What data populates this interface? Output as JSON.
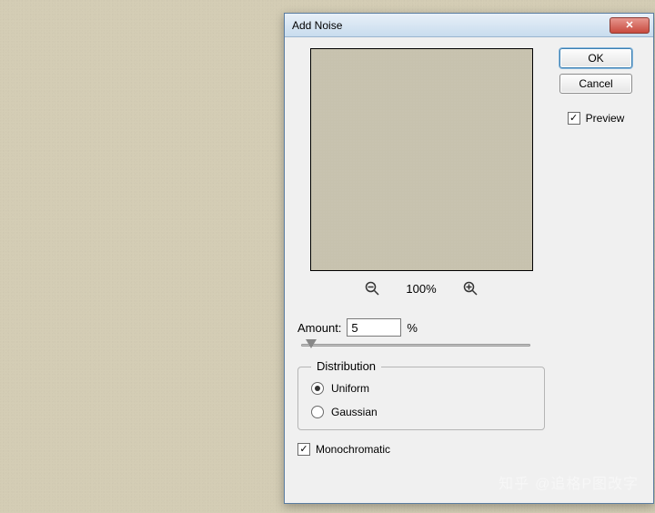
{
  "dialog": {
    "title": "Add Noise",
    "ok_label": "OK",
    "cancel_label": "Cancel",
    "preview_label": "Preview",
    "preview_checked": true,
    "zoom_level": "100%",
    "amount_label": "Amount:",
    "amount_value": "5",
    "amount_suffix": "%",
    "distribution": {
      "legend": "Distribution",
      "options": [
        {
          "label": "Uniform",
          "checked": true
        },
        {
          "label": "Gaussian",
          "checked": false
        }
      ]
    },
    "monochromatic_label": "Monochromatic",
    "monochromatic_checked": true
  },
  "watermark": {
    "brand": "知乎",
    "user": "@追格P图改字"
  }
}
